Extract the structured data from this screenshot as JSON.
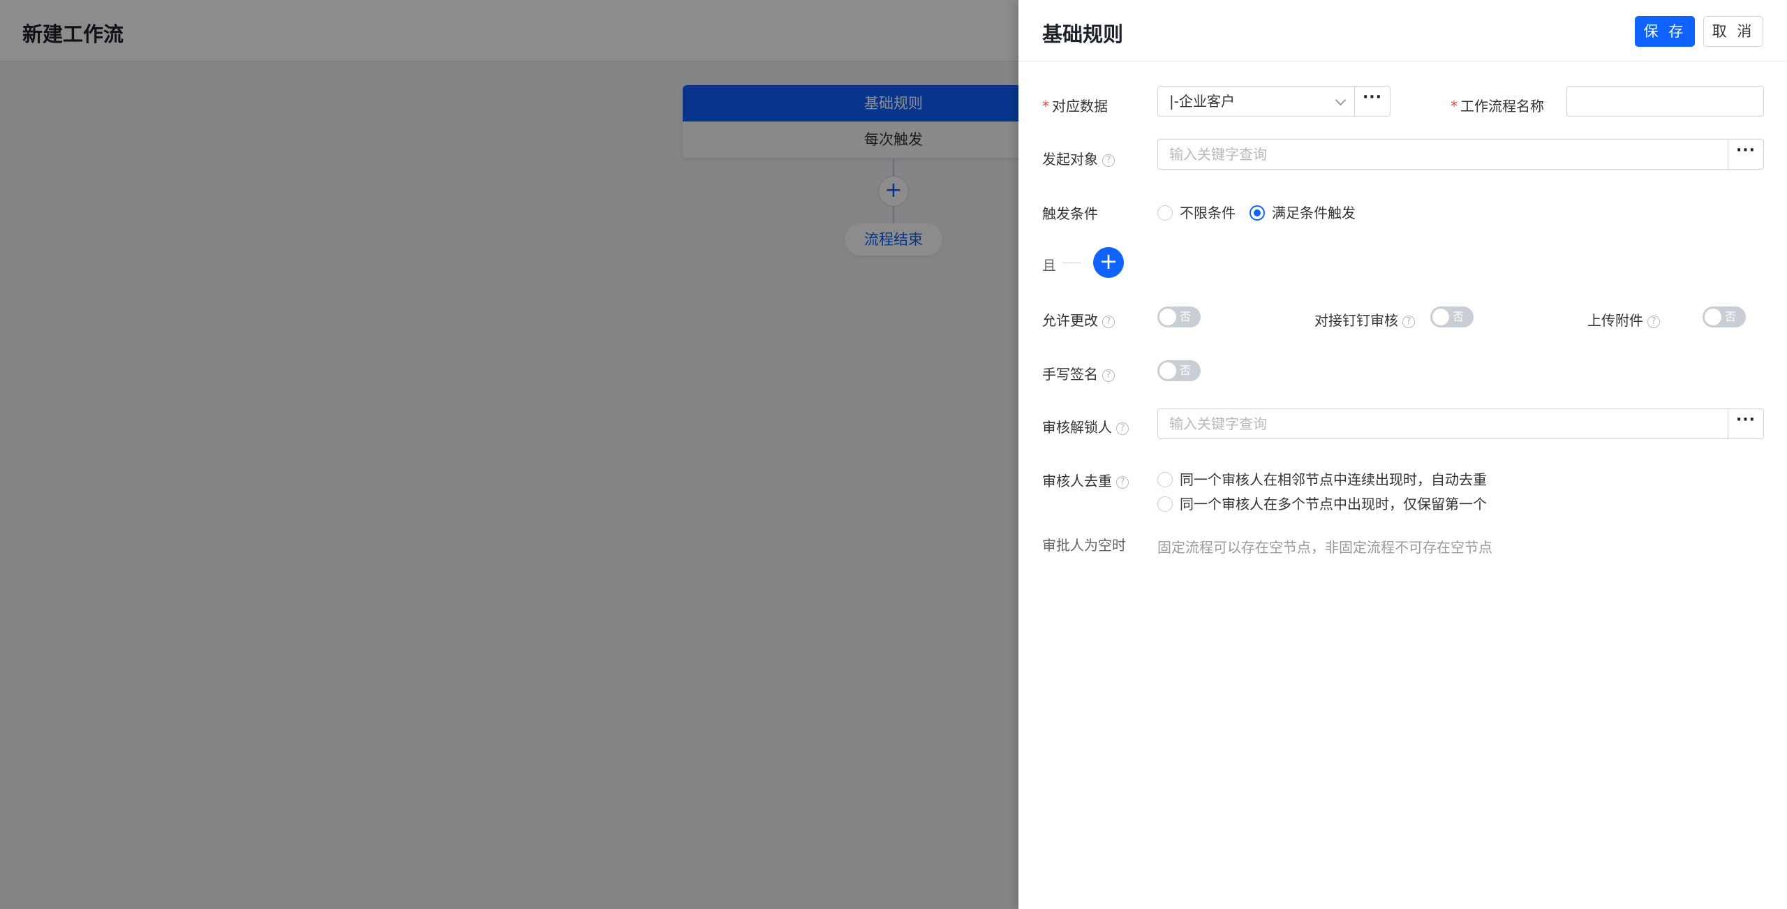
{
  "page": {
    "title": "新建工作流",
    "flow": {
      "node_title": "基础规则",
      "node_subtitle": "每次触发",
      "add_icon": "plus-icon",
      "end_label": "流程结束"
    }
  },
  "drawer": {
    "title": "基础规则",
    "save_label": "保 存",
    "cancel_label": "取 消",
    "fields": {
      "data_label": "对应数据",
      "data_value": "|-企业客户",
      "workflow_name_label": "工作流程名称",
      "workflow_name_value": "",
      "initiator_label": "发起对象",
      "initiator_placeholder": "输入关键字查询",
      "trigger_label": "触发条件",
      "trigger_options": [
        "不限条件",
        "满足条件触发"
      ],
      "trigger_selected": "满足条件触发",
      "and_label": "且",
      "allow_modify_label": "允许更改",
      "allow_modify_value": "否",
      "dingtalk_label": "对接钉钉审核",
      "dingtalk_value": "否",
      "upload_label": "上传附件",
      "upload_value": "否",
      "signature_label": "手写签名",
      "signature_value": "否",
      "unlocker_label": "审核解锁人",
      "unlocker_placeholder": "输入关键字查询",
      "dedupe_label": "审核人去重",
      "dedupe_options": [
        "同一个审核人在相邻节点中连续出现时，自动去重",
        "同一个审核人在多个节点中出现时，仅保留第一个"
      ],
      "empty_approver_label": "审批人为空时",
      "empty_approver_hint": "固定流程可以存在空节点，非固定流程不可存在空节点"
    },
    "more_label": "···",
    "help_icon": "question-circle-icon",
    "help_glyph": "?",
    "required_mark": "*",
    "add_glyph": "+"
  },
  "colors": {
    "primary": "#0f62fe",
    "required": "#f53f3f",
    "switch_off": "#c9cdd4"
  }
}
